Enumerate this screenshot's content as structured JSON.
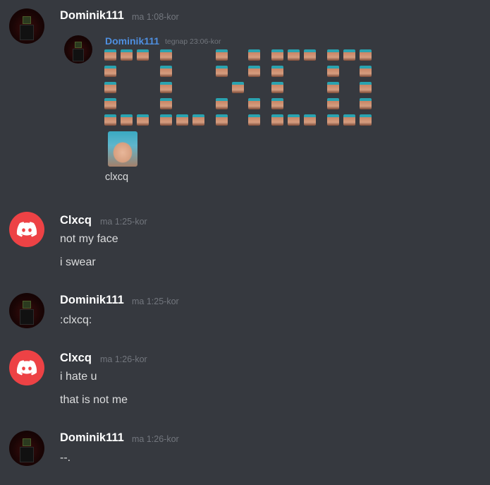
{
  "messages": [
    {
      "author": "Dominik111",
      "timestamp": "ma 1:08-kor"
    },
    {
      "author": "Clxcq",
      "timestamp": "ma 1:25-kor",
      "lines": [
        "not my face",
        "i swear"
      ]
    },
    {
      "author": "Dominik111",
      "timestamp": "ma 1:25-kor",
      "lines": [
        ":clxcq:"
      ]
    },
    {
      "author": "Clxcq",
      "timestamp": "ma 1:26-kor",
      "lines": [
        "i hate u",
        "that is not me"
      ]
    },
    {
      "author": "Dominik111",
      "timestamp": "ma 1:26-kor",
      "lines": [
        "--."
      ]
    }
  ],
  "quoted": {
    "author": "Dominik111",
    "timestamp": "tegnap 23:06-kor",
    "art_word": "CLXCQ",
    "caption": "clxcq"
  },
  "icons": {
    "discord_avatar": "discord-logo-icon",
    "user_avatar": "dark-figure-avatar"
  },
  "colors": {
    "background": "#36393f",
    "discord_red": "#ed4245",
    "link_name": "#4f8fe0"
  }
}
